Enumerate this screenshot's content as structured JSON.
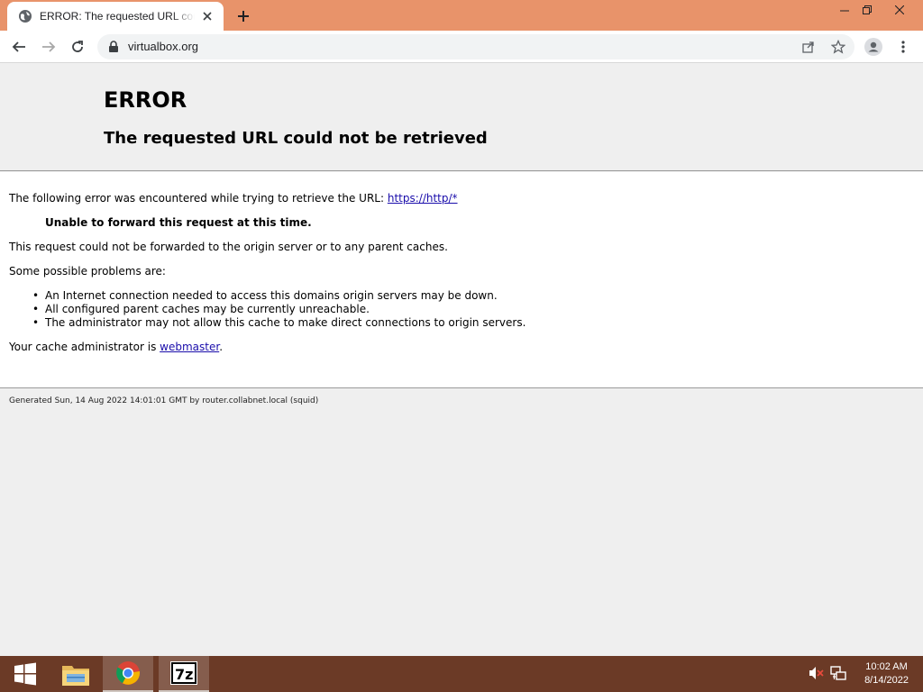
{
  "browser": {
    "tab_title": "ERROR: The requested URL could not be retrieved",
    "url": "virtualbox.org"
  },
  "page": {
    "heading": "ERROR",
    "subheading": "The requested URL could not be retrieved",
    "intro_text": "The following error was encountered while trying to retrieve the URL: ",
    "intro_link": "https://http/*",
    "error_title": "Unable to forward this request at this time.",
    "error_desc": "This request could not be forwarded to the origin server or to any parent caches.",
    "problems_intro": "Some possible problems are:",
    "problems": [
      "An Internet connection needed to access this domains origin servers may be down.",
      "All configured parent caches may be currently unreachable.",
      "The administrator may not allow this cache to make direct connections to origin servers."
    ],
    "admin_text": "Your cache administrator is ",
    "admin_link": "webmaster",
    "admin_suffix": ".",
    "footer": "Generated Sun, 14 Aug 2022 14:01:01 GMT by router.collabnet.local (squid)"
  },
  "taskbar": {
    "items": [
      "start-icon",
      "file-explorer-icon",
      "chrome-icon",
      "7zip-icon"
    ],
    "time": "10:02 AM",
    "date": "8/14/2022"
  },
  "colors": {
    "title_bar": "#e8936a",
    "taskbar": "#6b3a26",
    "link": "#1a0dab"
  }
}
